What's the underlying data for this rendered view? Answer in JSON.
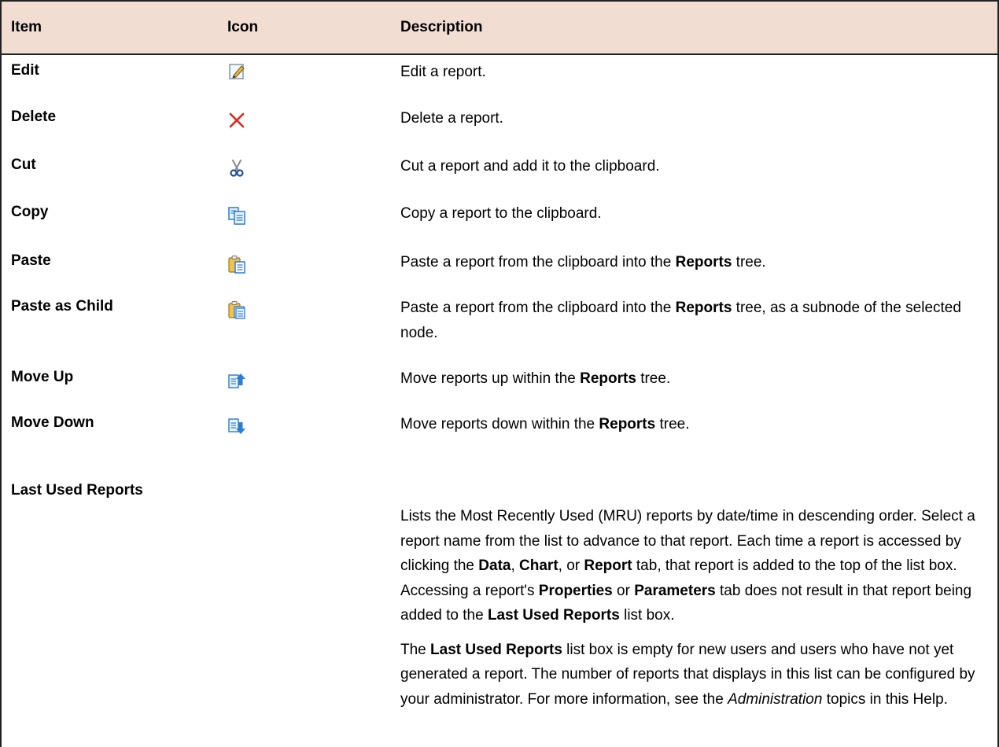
{
  "table": {
    "headers": {
      "item": "Item",
      "icon": "Icon",
      "description": "Description"
    },
    "rows": [
      {
        "item": "Edit",
        "icon": "edit-icon",
        "desc": "Edit a report."
      },
      {
        "item": "Delete",
        "icon": "delete-icon",
        "desc": "Delete a report."
      },
      {
        "item": "Cut",
        "icon": "cut-icon",
        "desc": "Cut a report and add it to the clipboard."
      },
      {
        "item": "Copy",
        "icon": "copy-icon",
        "desc": "Copy a report to the clipboard."
      },
      {
        "item": "Paste",
        "icon": "paste-icon",
        "desc_pre": "Paste a report from the clipboard into the ",
        "desc_bold": "Reports",
        "desc_post": " tree."
      },
      {
        "item": "Paste as Child",
        "icon": "paste-as-child-icon",
        "desc_pre": "Paste a report from the clipboard into the ",
        "desc_bold": "Reports",
        "desc_post": " tree, as a subnode of the selected node."
      },
      {
        "item": "Move Up",
        "icon": "move-up-icon",
        "desc_pre": "Move reports up within the ",
        "desc_bold": "Reports",
        "desc_post": " tree."
      },
      {
        "item": "Move Down",
        "icon": "move-down-icon",
        "desc_pre": "Move reports down within the ",
        "desc_bold": "Reports",
        "desc_post": " tree."
      }
    ],
    "last_used": {
      "item": "Last Used Reports",
      "p1": {
        "t1": "Lists the Most Recently Used (MRU) reports by date/time in descending order. Select a report name from the list to advance to that report. Each time a report is accessed by clicking the ",
        "b1": "Data",
        "t2": ", ",
        "b2": "Chart",
        "t3": ", or ",
        "b3": "Report",
        "t4": " tab, that report is added to the top of the list box. Accessing a report's ",
        "b4": "Properties",
        "t5": " or ",
        "b5": "Parameters",
        "t6": " tab does not result in that report being added to the ",
        "b6": "Last Used Reports",
        "t7": " list box."
      },
      "p2": {
        "t1": "The ",
        "b1": "Last Used Reports",
        "t2": " list box is empty for new users and users who have not yet generated a report. The number of reports that displays in this list can be configured by your administrator. For more information, see the ",
        "i1": "Administration",
        "t3": " topics in this Help."
      }
    }
  },
  "colors": {
    "header_bg": "#f1ddd2",
    "delete_red": "#e0231c",
    "icon_blue": "#2b7cd3"
  }
}
